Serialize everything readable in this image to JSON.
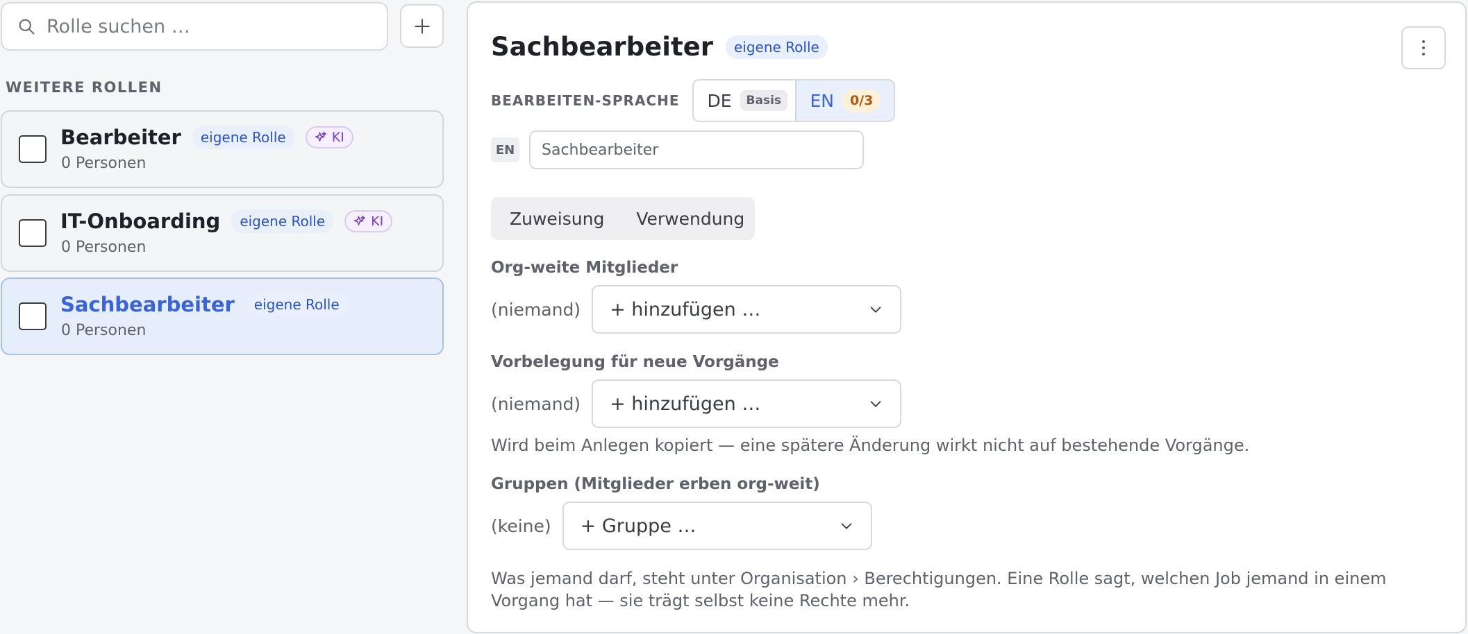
{
  "search": {
    "placeholder": "Rolle suchen …"
  },
  "sidebar": {
    "section_label": "WEITERE ROLLEN",
    "roles": [
      {
        "name": "Bearbeiter",
        "badge_own": "eigene Rolle",
        "badge_ki": "KI",
        "count": "0 Personen",
        "selected": false
      },
      {
        "name": "IT-Onboarding",
        "badge_own": "eigene Rolle",
        "badge_ki": "KI",
        "count": "0 Personen",
        "selected": false
      },
      {
        "name": "Sachbearbeiter",
        "badge_own": "eigene Rolle",
        "count": "0 Personen",
        "selected": true
      }
    ]
  },
  "detail": {
    "title": "Sachbearbeiter",
    "badge_own": "eigene Rolle",
    "language": {
      "label": "BEARBEITEN-SPRACHE",
      "options": [
        {
          "code": "DE",
          "tag": "Basis"
        },
        {
          "code": "EN",
          "tag": "0/3"
        }
      ],
      "active": "EN"
    },
    "name_field": {
      "lang": "EN",
      "value": "Sachbearbeiter"
    },
    "tabs": [
      "Zuweisung",
      "Verwendung"
    ],
    "org_members": {
      "label": "Org-weite Mitglieder",
      "empty": "(niemand)",
      "select": "+ hinzufügen …"
    },
    "defaults": {
      "label": "Vorbelegung für neue Vorgänge",
      "empty": "(niemand)",
      "select": "+ hinzufügen …",
      "hint": "Wird beim Anlegen kopiert — eine spätere Änderung wirkt nicht auf bestehende Vorgänge."
    },
    "groups": {
      "label": "Gruppen (Mitglieder erben org-weit)",
      "empty": "(keine)",
      "select": "+ Gruppe …"
    },
    "footer_note": "Was jemand darf, steht unter Organisation › Berechtigungen. Eine Rolle sagt, welchen Job jemand in einem Vorgang hat — sie trägt selbst keine Rechte mehr."
  },
  "colors": {
    "accent": "#3b63d8",
    "selected_bg": "#e6eefc",
    "ki": "#7a3fc4",
    "count_tag": "#b25a0c"
  },
  "icons": {
    "search": "search-icon",
    "add": "plus-icon",
    "more": "more-vertical-icon",
    "ki": "sparkles-icon",
    "dropdown": "chevron-down-icon"
  }
}
